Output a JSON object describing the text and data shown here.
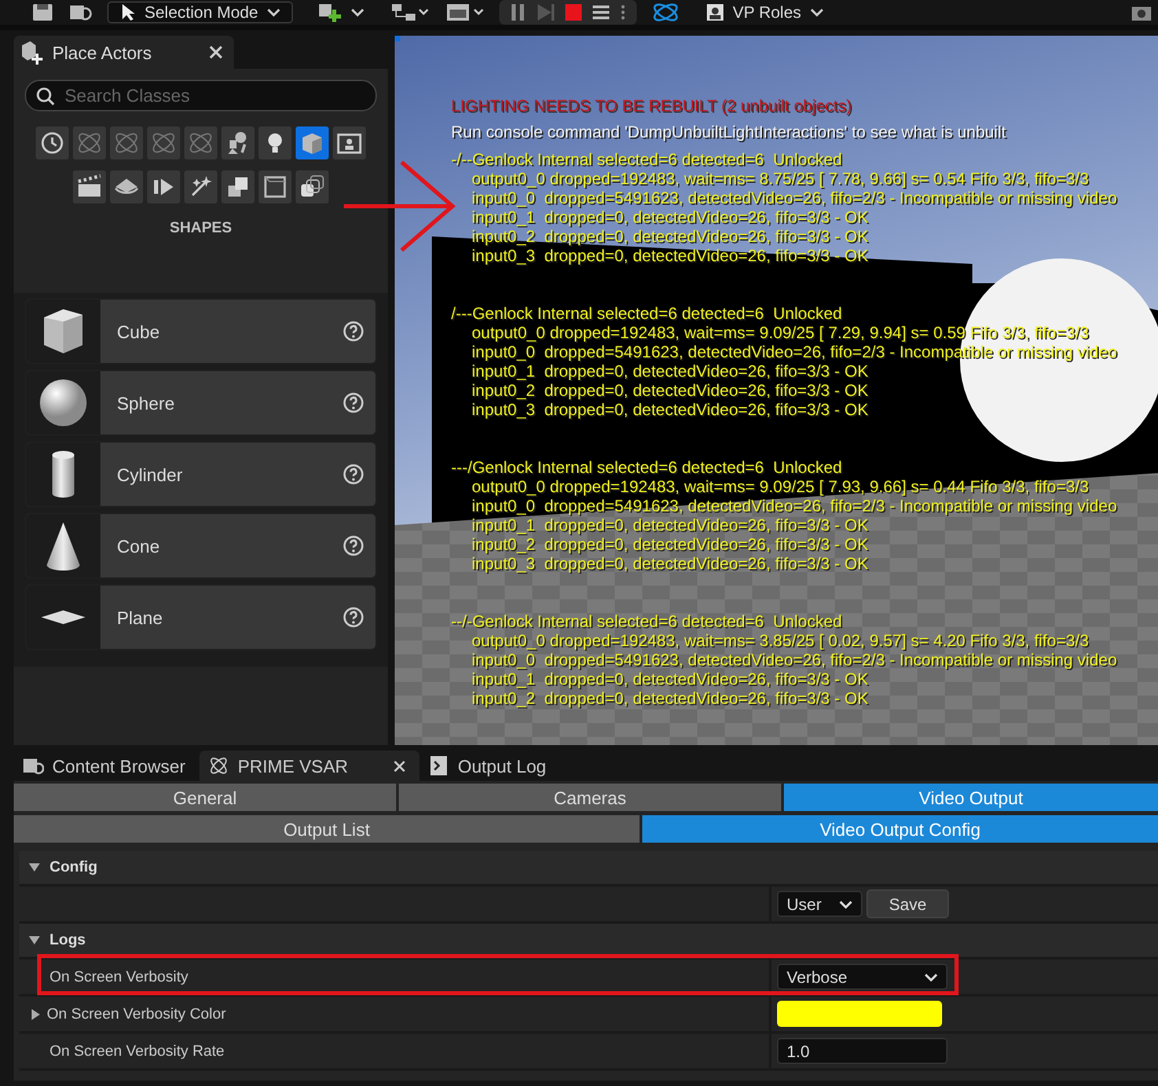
{
  "toolbar": {
    "mode_dropdown": "Selection Mode",
    "roles_dropdown": "VP Roles"
  },
  "place_actors": {
    "title": "Place Actors",
    "search": {
      "placeholder": "Search Classes"
    },
    "categories": [
      {
        "kind": "recent",
        "selected": false
      },
      {
        "kind": "plugin",
        "selected": false
      },
      {
        "kind": "plugin",
        "selected": false
      },
      {
        "kind": "plugin",
        "selected": false
      },
      {
        "kind": "plugin",
        "selected": false
      },
      {
        "kind": "basic",
        "selected": false
      },
      {
        "kind": "light",
        "selected": false
      },
      {
        "kind": "shape",
        "selected": true
      },
      {
        "kind": "portrait",
        "selected": false
      },
      {
        "kind": "cinematic",
        "selected": false
      },
      {
        "kind": "visual",
        "selected": false
      },
      {
        "kind": "media",
        "selected": false
      },
      {
        "kind": "sparkle",
        "selected": false
      },
      {
        "kind": "geometry",
        "selected": false
      },
      {
        "kind": "volume",
        "selected": false
      },
      {
        "kind": "stack",
        "selected": false
      }
    ],
    "section_title": "SHAPES",
    "items": [
      {
        "kind": "cube",
        "label": "Cube"
      },
      {
        "kind": "sphere",
        "label": "Sphere"
      },
      {
        "kind": "cylinder",
        "label": "Cylinder"
      },
      {
        "kind": "cone",
        "label": "Cone"
      },
      {
        "kind": "plane",
        "label": "Plane"
      }
    ]
  },
  "viewport": {
    "warning": "LIGHTING NEEDS TO BE REBUILT (2 unbuilt objects)",
    "hint": "Run console command 'DumpUnbuiltLightInteractions' to see what is unbuilt",
    "blocks": [
      {
        "header": "-/--Genlock Internal selected=6 detected=6  Unlocked",
        "lines": [
          "output0_0 dropped=192483, wait=ms= 8.75/25 [ 7.78, 9.66] s= 0.54 Fifo 3/3, fifo=3/3",
          "input0_0  dropped=5491623, detectedVideo=26, fifo=2/3 - Incompatible or missing video",
          "input0_1  dropped=0, detectedVideo=26, fifo=3/3 - OK",
          "input0_2  dropped=0, detectedVideo=26, fifo=3/3 - OK",
          "input0_3  dropped=0, detectedVideo=26, fifo=3/3 - OK"
        ]
      },
      {
        "header": "/---Genlock Internal selected=6 detected=6  Unlocked",
        "lines": [
          "output0_0 dropped=192483, wait=ms= 9.09/25 [ 7.29, 9.94] s= 0.59 Fifo 3/3, fifo=3/3",
          "input0_0  dropped=5491623, detectedVideo=26, fifo=2/3 - Incompatible or missing video",
          "input0_1  dropped=0, detectedVideo=26, fifo=3/3 - OK",
          "input0_2  dropped=0, detectedVideo=26, fifo=3/3 - OK",
          "input0_3  dropped=0, detectedVideo=26, fifo=3/3 - OK"
        ]
      },
      {
        "header": "---/Genlock Internal selected=6 detected=6  Unlocked",
        "lines": [
          "output0_0 dropped=192483, wait=ms= 9.09/25 [ 7.93, 9.66] s= 0.44 Fifo 3/3, fifo=3/3",
          "input0_0  dropped=5491623, detectedVideo=26, fifo=2/3 - Incompatible or missing video",
          "input0_1  dropped=0, detectedVideo=26, fifo=3/3 - OK",
          "input0_2  dropped=0, detectedVideo=26, fifo=3/3 - OK",
          "input0_3  dropped=0, detectedVideo=26, fifo=3/3 - OK"
        ]
      },
      {
        "header": "--/-Genlock Internal selected=6 detected=6  Unlocked",
        "lines": [
          "output0_0 dropped=192483, wait=ms= 3.85/25 [ 0.02, 9.57] s= 4.20 Fifo 3/3, fifo=3/3",
          "input0_0  dropped=5491623, detectedVideo=26, fifo=2/3 - Incompatible or missing video",
          "input0_1  dropped=0, detectedVideo=26, fifo=3/3 - OK",
          "input0_2  dropped=0, detectedVideo=26, fifo=3/3 - OK"
        ]
      }
    ]
  },
  "bottom_panel": {
    "tabs": [
      {
        "kind": "content",
        "label": "Content Browser",
        "selected": false
      },
      {
        "kind": "plugin",
        "label": "PRIME VSAR",
        "selected": true
      },
      {
        "kind": "log",
        "label": "Output Log",
        "selected": false
      }
    ],
    "main_tabs": [
      {
        "label": "General",
        "selected": false
      },
      {
        "label": "Cameras",
        "selected": false
      },
      {
        "label": "Video Output",
        "selected": true
      }
    ],
    "sub_tabs": [
      {
        "label": "Output List",
        "selected": false
      },
      {
        "label": "Video Output Config",
        "selected": true
      }
    ],
    "sections": [
      {
        "title": "Config",
        "expanded": true,
        "rows": [
          {
            "kind": "preset",
            "value": "User",
            "button": "Save"
          }
        ]
      },
      {
        "title": "Logs",
        "expanded": true,
        "rows": [
          {
            "kind": "dropdown",
            "label": "On Screen Verbosity",
            "value": "Verbose",
            "highlighted": true
          },
          {
            "kind": "color",
            "label": "On Screen Verbosity Color",
            "color": "#ffff00",
            "expanded": false
          },
          {
            "kind": "number",
            "label": "On Screen Verbosity Rate",
            "value": "1.0"
          }
        ]
      }
    ]
  }
}
